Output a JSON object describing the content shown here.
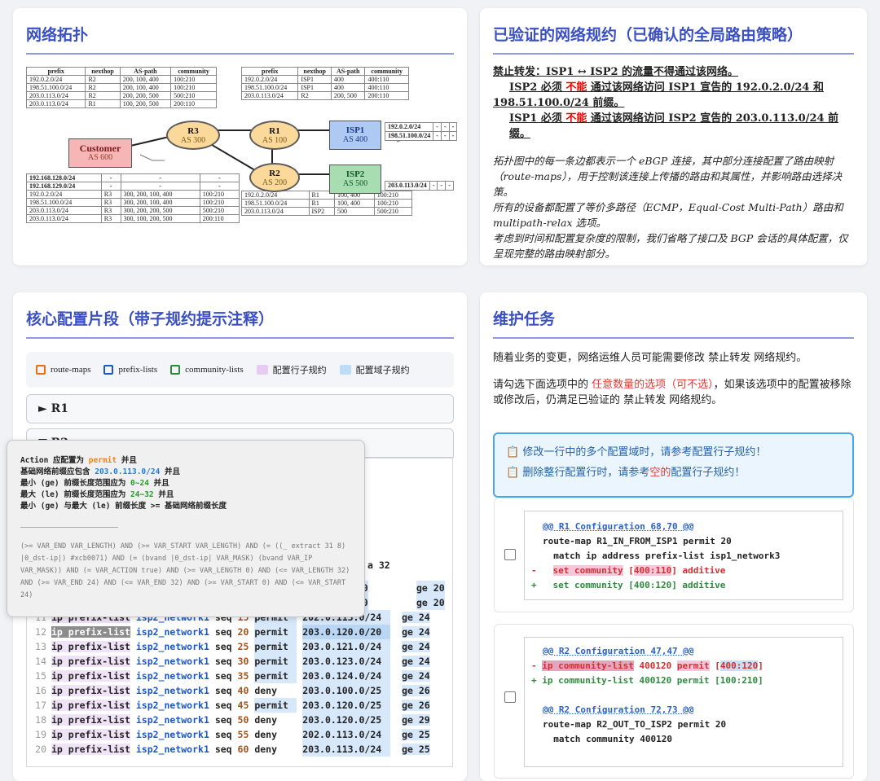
{
  "topology": {
    "title": "网络拓扑",
    "nodes": [
      {
        "id": "r3",
        "name": "R3",
        "as": "AS 300"
      },
      {
        "id": "r1",
        "name": "R1",
        "as": "AS 100"
      },
      {
        "id": "r2",
        "name": "R2",
        "as": "AS 200"
      },
      {
        "id": "customer",
        "name": "Customer",
        "as": "AS 600"
      },
      {
        "id": "isp1",
        "name": "ISP1",
        "as": "AS 400"
      },
      {
        "id": "isp2",
        "name": "ISP2",
        "as": "AS 500"
      }
    ],
    "headers": [
      "prefix",
      "nexthop",
      "AS-path",
      "community"
    ],
    "table_r3": [
      [
        "192.0.2.0/24",
        "R2",
        "200, 100, 400",
        "100:210"
      ],
      [
        "198.51.100.0/24",
        "R2",
        "200, 100, 400",
        "100:210"
      ],
      [
        "203.0.113.0/24",
        "R2",
        "200, 200, 500",
        "500:210"
      ],
      [
        "203.0.113.0/24",
        "R1",
        "100, 200, 500",
        "200:110"
      ]
    ],
    "table_r1": [
      [
        "192.0.2.0/24",
        "ISP1",
        "400",
        "400:110"
      ],
      [
        "198.51.100.0/24",
        "ISP1",
        "400",
        "400:110"
      ],
      [
        "203.0.113.0/24",
        "R2",
        "200, 500",
        "200:110"
      ]
    ],
    "table_customer": [
      [
        "192.168.128.0/24",
        "-",
        "-",
        "-"
      ],
      [
        "192.168.129.0/24",
        "-",
        "-",
        "-"
      ],
      [
        "192.0.2.0/24",
        "R3",
        "300, 200, 100, 400",
        "100:210"
      ],
      [
        "198.51.100.0/24",
        "R3",
        "300, 200, 100, 400",
        "100:210"
      ],
      [
        "203.0.113.0/24",
        "R3",
        "300, 200, 200, 500",
        "500:210"
      ],
      [
        "203.0.113.0/24",
        "R3",
        "300, 100, 200, 500",
        "200:110"
      ]
    ],
    "table_r2": [
      [
        "192.0.2.0/24",
        "R1",
        "100, 400",
        "100:210"
      ],
      [
        "198.51.100.0/24",
        "R1",
        "100, 400",
        "100:210"
      ],
      [
        "203.0.113.0/24",
        "ISP2",
        "500",
        "500:210"
      ]
    ],
    "isp1_prefixes": [
      "192.0.2.0/24",
      "198.51.100.0/24"
    ],
    "isp2_prefixes": [
      "203.0.113.0/24"
    ],
    "dash": "-"
  },
  "spec": {
    "title": "已验证的网络规约（已确认的全局路由策略）",
    "line1": "禁止转发：ISP1 ↔ ISP2 的流量不得通过该网络。",
    "line2a": "ISP2 必须 ",
    "line2b": "不能",
    "line2c": " 通过该网络访问 ISP1 宣告的 192.0.2.0/24 和",
    "line3": "198.51.100.0/24 前缀。",
    "line4a": "ISP1 必须 ",
    "line4b": "不能",
    "line4c": " 通过该网络访问 ISP2 宣告的 203.0.113.0/24 前缀。",
    "para1": "拓扑图中的每一条边都表示一个 eBGP 连接，其中部分连接配置了路由映射（route-maps），用于控制该连接上传播的路由和其属性，并影响路由选择决策。",
    "para2": "所有的设备都配置了等价多路径（ECMP，Equal-Cost Multi-Path）路由和 multipath-relax 选项。",
    "para3": "考虑到时间和配置复杂度的限制，我们省略了接口及 BGP 会话的具体配置，仅呈现完整的路由映射部分。"
  },
  "config": {
    "title": "核心配置片段（带子规约提示注释）",
    "legend": [
      "route-maps",
      "prefix-lists",
      "community-lists",
      "配置行子规约",
      "配置域子规约"
    ],
    "legend_colors": [
      "#e8701a",
      "#1d56c5",
      "#2e8b3e",
      "#e6ccf0",
      "#bcdcf8"
    ],
    "acc_r1": "► R1",
    "acc_r2": "▼ R2",
    "partial_tail": "a 32",
    "rows": [
      {
        "n": "",
        "seq": "",
        "act": "",
        "pfx": ".0/20",
        "ge": "ge 20"
      },
      {
        "n": "",
        "seq": "",
        "act": "",
        "pfx": ".0/20",
        "ge": "ge 20"
      },
      {
        "n": "11",
        "kw": "ip prefix-list",
        "name": "isp2_network1",
        "seq": "15",
        "act": "permit",
        "pfx": "202.0.113.0/24",
        "ge": "ge 24"
      },
      {
        "n": "12",
        "kw": "ip prefix-list",
        "name": "isp2_network1",
        "seq": "20",
        "act": "permit",
        "pfx": "203.0.120.0/20",
        "ge": "ge 24"
      },
      {
        "n": "13",
        "kw": "ip prefix-list",
        "name": "isp2_network1",
        "seq": "25",
        "act": "permit",
        "pfx": "203.0.121.0/24",
        "ge": "ge 24"
      },
      {
        "n": "14",
        "kw": "ip prefix-list",
        "name": "isp2_network1",
        "seq": "30",
        "act": "permit",
        "pfx": "203.0.123.0/24",
        "ge": "ge 24"
      },
      {
        "n": "15",
        "kw": "ip prefix-list",
        "name": "isp2_network1",
        "seq": "35",
        "act": "permit",
        "pfx": "203.0.124.0/24",
        "ge": "ge 24"
      },
      {
        "n": "16",
        "kw": "ip prefix-list",
        "name": "isp2_network1",
        "seq": "40",
        "act": "deny",
        "pfx": "203.0.100.0/25",
        "ge": "ge 26"
      },
      {
        "n": "17",
        "kw": "ip prefix-list",
        "name": "isp2_network1",
        "seq": "45",
        "act": "permit",
        "pfx": "203.0.120.0/25",
        "ge": "ge 26"
      },
      {
        "n": "18",
        "kw": "ip prefix-list",
        "name": "isp2_network1",
        "seq": "50",
        "act": "deny",
        "pfx": "203.0.120.0/25",
        "ge": "ge 29"
      },
      {
        "n": "19",
        "kw": "ip prefix-list",
        "name": "isp2_network1",
        "seq": "55",
        "act": "deny",
        "pfx": "202.0.113.0/24",
        "ge": "ge 25"
      },
      {
        "n": "20",
        "kw": "ip prefix-list",
        "name": "isp2_network1",
        "seq": "60",
        "act": "deny",
        "pfx": "203.0.113.0/24",
        "ge": "ge 25"
      }
    ]
  },
  "tooltip": {
    "l1a": "Action 应配置为 ",
    "l1b": "permit",
    "l1c": " 并且",
    "l2a": "基础网络前缀应包含 ",
    "l2b": "203.0.113.0/24",
    "l2c": " 并且",
    "l3a": "最小 (ge) 前缀长度范围应为 ",
    "l3b": "0~24",
    "l3c": " 并且",
    "l4a": "最大 (le) 前缀长度范围应为 ",
    "l4b": "24~32",
    "l4c": " 并且",
    "l5": "最小 (ge) 与最大 (le) 前缀长度 >= 基础网络前缀长度",
    "expr": "(>= VAR_END VAR_LENGTH) AND (>= VAR_START VAR_LENGTH) AND (= ((_ extract 31 8) |0_dst-ip|) #xcb0071) AND (= (bvand |0_dst-ip| VAR_MASK) (bvand VAR_IP VAR_MASK)) AND (= VAR_ACTION true) AND (>= VAR_LENGTH 0) AND (<= VAR_LENGTH 32) AND (>= VAR_END 24) AND (<= VAR_END 32) AND (>= VAR_START 0) AND (<= VAR_START 24)"
  },
  "task": {
    "title": "维护任务",
    "p1": "随着业务的变更，网络运维人员可能需要修改 禁止转发 网络规约。",
    "p2a": "请勾选下面选项中的 ",
    "p2b": "任意数量的选项（可不选）",
    "p2c": "，如果该选项中的配置被移除或修改后，仍满足已验证的 禁止转发 网络规约。",
    "tip1": "📋 修改一行中的多个配置域时，请参考配置行子规约！",
    "tip2a": "📋 删除整行配置行时，请参考",
    "tip2b": "空的",
    "tip2c": "配置行子规约！",
    "opt1": {
      "h": "@@ R1 Configuration 68,70 @@",
      "c1": "route-map R1_IN_FROM_ISP1 permit 20",
      "c2": "  match ip address prefix-list isp1_network3",
      "rm_a": "set community",
      "rm_b": "400:110",
      "rm_c": " additive",
      "ad": "  set community [400:120] additive"
    },
    "opt2": {
      "h1": "@@ R2 Configuration 47,47 @@",
      "rm_a": "ip community-list",
      "rm_b": " 400120 ",
      "rm_c": "permit",
      "rm_d": "400:120",
      "ad": "+ ip community-list 400120 permit [100:210]",
      "h2": "@@ R2 Configuration 72,73 @@",
      "c1": "route-map R2_OUT_TO_ISP2 permit 20",
      "c2": "  match community 400120"
    }
  }
}
